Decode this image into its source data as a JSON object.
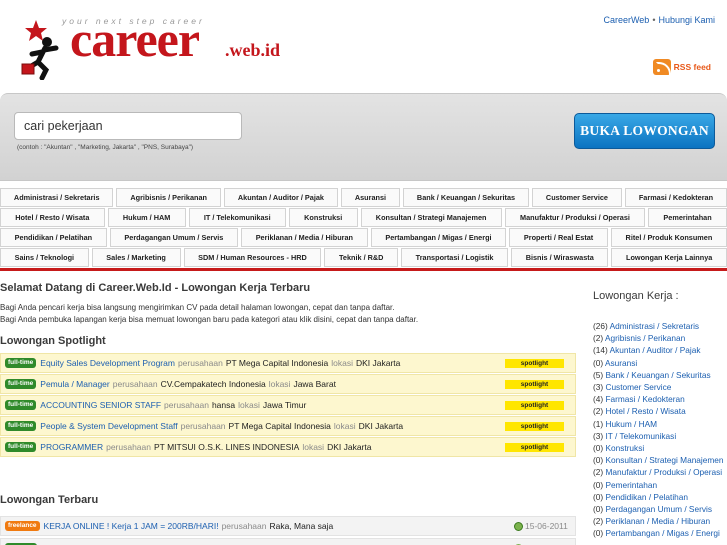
{
  "header": {
    "tagline": "your next step career",
    "logo_text": "career",
    "logo_suffix": ".web.id",
    "top_links": [
      "CareerWeb",
      "Hubungi Kami"
    ],
    "top_links_separator": "•",
    "rss_label": "RSS feed"
  },
  "search": {
    "value": "cari pekerjaan",
    "hint": "(contoh : \"Akuntan\" , \"Marketing, Jakarta\" , \"PNS, Surabaya\")",
    "button_label": "BUKA LOWONGAN"
  },
  "categories": [
    [
      "Administrasi / Sekretaris",
      "Agribisnis / Perikanan",
      "Akuntan / Auditor / Pajak",
      "Asuransi",
      "Bank / Keuangan / Sekuritas",
      "Customer Service",
      "Farmasi / Kedokteran"
    ],
    [
      "Hotel / Resto / Wisata",
      "Hukum / HAM",
      "IT / Telekomunikasi",
      "Konstruksi",
      "Konsultan / Strategi Manajemen",
      "Manufaktur / Produksi / Operasi",
      "Pemerintahan"
    ],
    [
      "Pendidikan / Pelatihan",
      "Perdagangan Umum / Servis",
      "Periklanan / Media / Hiburan",
      "Pertambangan / Migas / Energi",
      "Properti / Real Estat",
      "Ritel / Produk Konsumen"
    ],
    [
      "Sains / Teknologi",
      "Sales / Marketing",
      "SDM / Human Resources - HRD",
      "Teknik / R&D",
      "Transportasi / Logistik",
      "Bisnis / Wiraswasta",
      "Lowongan Kerja Lainnya"
    ]
  ],
  "main": {
    "welcome_title": "Selamat Datang di Career.Web.Id - Lowongan Kerja Terbaru",
    "intro_lines": [
      "Bagi Anda pencari kerja bisa langsung mengirimkan CV pada detail halaman lowongan, cepat dan tanpa daftar.",
      "Bagi Anda pembuka lapangan kerja bisa memuat lowongan baru pada kategori atau klik disini, cepat dan tanpa daftar."
    ],
    "spotlight_title": "Lowongan Spotlight",
    "label_company": "perusahaan",
    "label_location": "lokasi",
    "spotlight_tag": "spotlight",
    "spotlight_jobs": [
      {
        "type": "full-time",
        "title": "Equity Sales Development Program",
        "company": "PT Mega Capital Indonesia",
        "location": "DKI Jakarta"
      },
      {
        "type": "full-time",
        "title": "Pemula / Manager",
        "company": "CV.Cempakatech Indonesia",
        "location": "Jawa Barat"
      },
      {
        "type": "full-time",
        "title": "ACCOUNTING SENIOR STAFF",
        "company": "hansa",
        "location": "Jawa Timur"
      },
      {
        "type": "full-time",
        "title": "People & System Development Staff",
        "company": "PT Mega Capital Indonesia",
        "location": "DKI Jakarta"
      },
      {
        "type": "full-time",
        "title": "PROGRAMMER",
        "company": "PT MITSUI O.S.K. LINES INDONESIA",
        "location": "DKI Jakarta"
      }
    ],
    "newest_title": "Lowongan Terbaru",
    "newest_jobs": [
      {
        "type": "freelance",
        "title": "KERJA ONLINE ! Kerja 1 JAM = 200RB/HARI!",
        "company": "Raka, Mana saja",
        "date": "15-06-2011"
      }
    ]
  },
  "sidebar": {
    "title": "Lowongan Kerja :",
    "items": [
      {
        "count": "(26)",
        "name": "Administrasi / Sekretaris"
      },
      {
        "count": "(2)",
        "name": "Agribisnis / Perikanan"
      },
      {
        "count": "(14)",
        "name": "Akuntan / Auditor / Pajak"
      },
      {
        "count": "(0)",
        "name": "Asuransi"
      },
      {
        "count": "(5)",
        "name": "Bank / Keuangan / Sekuritas"
      },
      {
        "count": "(3)",
        "name": "Customer Service"
      },
      {
        "count": "(4)",
        "name": "Farmasi / Kedokteran"
      },
      {
        "count": "(2)",
        "name": "Hotel / Resto / Wisata"
      },
      {
        "count": "(1)",
        "name": "Hukum / HAM"
      },
      {
        "count": "(3)",
        "name": "IT / Telekomunikasi"
      },
      {
        "count": "(0)",
        "name": "Konstruksi"
      },
      {
        "count": "(0)",
        "name": "Konsultan / Strategi Manajemen"
      },
      {
        "count": "(2)",
        "name": "Manufaktur / Produksi / Operasi"
      },
      {
        "count": "(0)",
        "name": "Pemerintahan"
      },
      {
        "count": "(0)",
        "name": "Pendidikan / Pelatihan"
      },
      {
        "count": "(0)",
        "name": "Perdagangan Umum / Servis"
      },
      {
        "count": "(2)",
        "name": "Periklanan / Media / Hiburan"
      },
      {
        "count": "(0)",
        "name": "Pertambangan / Migas / Energi"
      }
    ]
  }
}
